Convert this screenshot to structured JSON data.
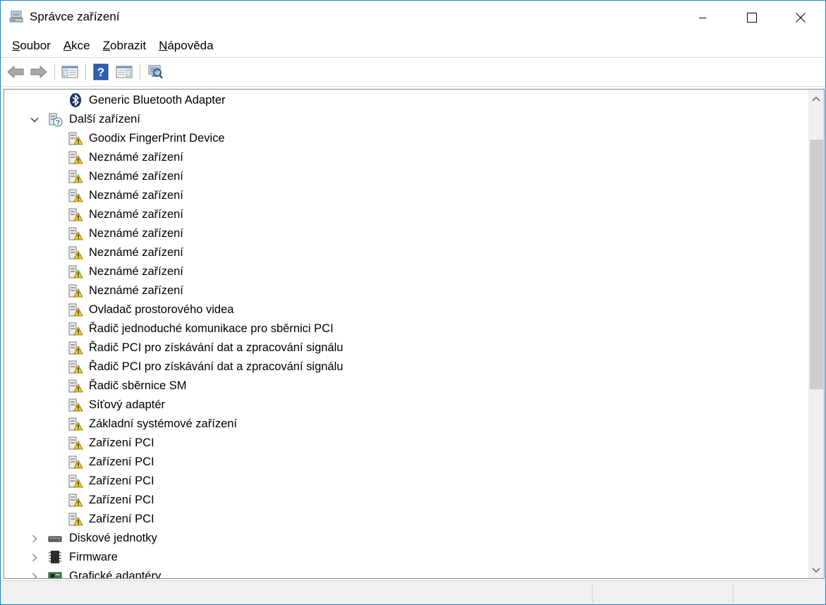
{
  "window": {
    "title": "Správce zařízení",
    "icon": "device-manager-icon",
    "accent_color": "#1883d7"
  },
  "menu": {
    "items": [
      {
        "accel": "S",
        "rest": "oubor"
      },
      {
        "accel": "A",
        "rest": "kce"
      },
      {
        "accel": "Z",
        "rest": "obrazit"
      },
      {
        "accel": "N",
        "rest": "ápověda"
      }
    ]
  },
  "toolbar": {
    "buttons": [
      "back-arrow-icon",
      "forward-arrow-icon",
      "show-hide-console-tree-icon",
      "help-icon",
      "properties-pane-icon",
      "scan-hardware-changes-icon"
    ]
  },
  "tree": {
    "items": [
      {
        "level": 1,
        "label": "Generic Bluetooth Adapter",
        "icon": "bluetooth-icon"
      },
      {
        "level": 0,
        "label": "Další zařízení",
        "icon": "unknown-device-category-icon",
        "expanded": true
      },
      {
        "level": 1,
        "label": "Goodix FingerPrint Device",
        "icon": "warning-device-icon"
      },
      {
        "level": 1,
        "label": "Neznámé zařízení",
        "icon": "warning-device-icon"
      },
      {
        "level": 1,
        "label": "Neznámé zařízení",
        "icon": "warning-device-icon"
      },
      {
        "level": 1,
        "label": "Neznámé zařízení",
        "icon": "warning-device-icon"
      },
      {
        "level": 1,
        "label": "Neznámé zařízení",
        "icon": "warning-device-icon"
      },
      {
        "level": 1,
        "label": "Neznámé zařízení",
        "icon": "warning-device-icon"
      },
      {
        "level": 1,
        "label": "Neznámé zařízení",
        "icon": "warning-device-icon"
      },
      {
        "level": 1,
        "label": "Neznámé zařízení",
        "icon": "warning-device-icon"
      },
      {
        "level": 1,
        "label": "Neznámé zařízení",
        "icon": "warning-device-icon"
      },
      {
        "level": 1,
        "label": "Ovladač prostorového videa",
        "icon": "warning-device-icon"
      },
      {
        "level": 1,
        "label": "Řadič jednoduché komunikace pro sběrnici PCI",
        "icon": "warning-device-icon"
      },
      {
        "level": 1,
        "label": "Řadič PCI pro získávání dat a zpracování signálu",
        "icon": "warning-device-icon"
      },
      {
        "level": 1,
        "label": "Řadič PCI pro získávání dat a zpracování signálu",
        "icon": "warning-device-icon"
      },
      {
        "level": 1,
        "label": "Řadič sběrnice SM",
        "icon": "warning-device-icon"
      },
      {
        "level": 1,
        "label": "Síťový adaptér",
        "icon": "warning-device-icon"
      },
      {
        "level": 1,
        "label": "Základní systémové zařízení",
        "icon": "warning-device-icon"
      },
      {
        "level": 1,
        "label": "Zařízení PCI",
        "icon": "warning-device-icon"
      },
      {
        "level": 1,
        "label": "Zařízení PCI",
        "icon": "warning-device-icon"
      },
      {
        "level": 1,
        "label": "Zařízení PCI",
        "icon": "warning-device-icon"
      },
      {
        "level": 1,
        "label": "Zařízení PCI",
        "icon": "warning-device-icon"
      },
      {
        "level": 1,
        "label": "Zařízení PCI",
        "icon": "warning-device-icon"
      },
      {
        "level": 0,
        "label": "Diskové jednotky",
        "icon": "disk-drive-icon",
        "expanded": false
      },
      {
        "level": 0,
        "label": "Firmware",
        "icon": "firmware-icon",
        "expanded": false
      },
      {
        "level": 0,
        "label": "Grafické adaptéry",
        "icon": "display-adapter-icon",
        "expanded": false
      }
    ]
  },
  "scrollbar": {
    "position_fraction": 0.1,
    "visible_fraction": 0.55
  }
}
